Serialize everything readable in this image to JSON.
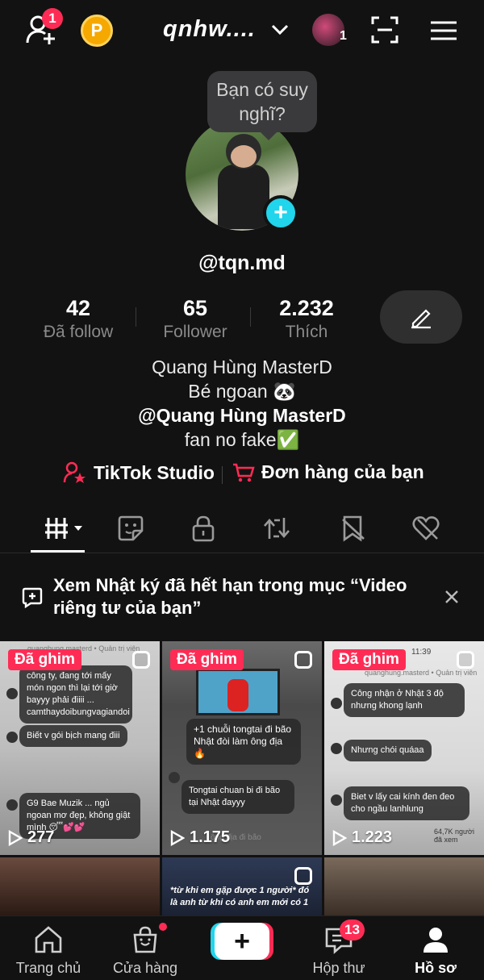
{
  "topbar": {
    "friend_requests_badge": "1",
    "username": "qnhw....",
    "account_count": "1",
    "icons": [
      "add-friend-icon",
      "coin-icon",
      "chevron-down-icon",
      "account-avatar",
      "scan-icon",
      "menu-icon"
    ],
    "coin_letter": "P"
  },
  "profile": {
    "thought_bubble": "Bạn có suy nghĩ?",
    "handle": "@tqn.md",
    "stats": [
      {
        "value": "42",
        "label": "Đã follow"
      },
      {
        "value": "65",
        "label": "Follower"
      },
      {
        "value": "2.232",
        "label": "Thích"
      }
    ],
    "bio_lines": [
      "Quang Hùng MasterD",
      "Bé ngoan 🐼",
      "@Quang Hùng MasterD",
      "fan no fake✅"
    ],
    "links": [
      {
        "label": "TikTok Studio",
        "icon": "studio-icon"
      },
      {
        "label": "Đơn hàng của bạn",
        "icon": "cart-icon"
      }
    ]
  },
  "tabs": [
    "videos-tab",
    "stickers-tab",
    "private-tab",
    "reposts-tab",
    "favorites-tab",
    "liked-tab"
  ],
  "notice": {
    "text": "Xem Nhật ký đã hết hạn trong mục “Video riêng tư của bạn”"
  },
  "videos": [
    {
      "pinned": "Đã ghim",
      "views": "277",
      "comments": [
        "công ty, đang tới mấy món ngon thì lại tới giờ bayyy phải điiii ... camthaydoibungvagiandoi",
        "Biết v gói bịch mang điii",
        "G9 Bae Muzik ... ngủ ngoan mơ đẹp, không giật mình 😴💕💕"
      ],
      "header": "quanghung.masterd • Quản trị viên"
    },
    {
      "pinned": "Đã ghim",
      "views": "1.175",
      "comments": [
        "+1 chuỗi tongtai đi bão Nhật đòi làm ông địa🔥",
        "Tongtai chuan bi đi bão tại Nhật đayyy"
      ],
      "footer": "ông địa đi bão"
    },
    {
      "pinned": "Đã ghim",
      "views": "1.223",
      "comments": [
        "Công nhận ở Nhật 3 độ nhưng khong lạnh",
        "Nhưng chói quáaa",
        "Biet v lấy cai kính đen đeo cho ngầu lanhlung"
      ],
      "header": "quanghung.masterd • Quản trị viên",
      "footer": "64,7K người đã xem",
      "time": "11:39"
    },
    {
      "views": ""
    },
    {
      "caption": "*từ khi em gặp được 1 người* đó là anh từ khi có anh em mới có 1"
    },
    {
      "views": ""
    }
  ],
  "bottom_nav": [
    {
      "label": "Trang chủ",
      "icon": "home-icon"
    },
    {
      "label": "Cửa hàng",
      "icon": "shop-icon"
    },
    {
      "label": "+",
      "icon": "create-icon"
    },
    {
      "label": "Hộp thư",
      "icon": "inbox-icon",
      "badge": "13"
    },
    {
      "label": "Hồ sơ",
      "icon": "profile-icon"
    }
  ],
  "colors": {
    "accent": "#fe2c55",
    "cyan": "#20d5ec",
    "background": "#121212"
  }
}
